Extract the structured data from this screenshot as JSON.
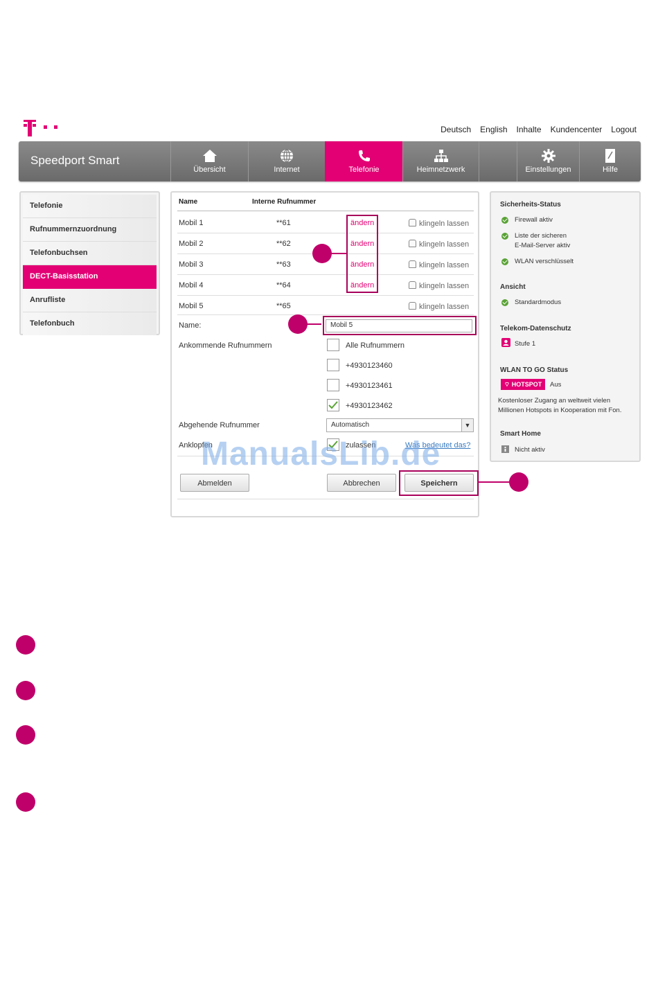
{
  "brand_color": "#e20074",
  "top_links": [
    "Deutsch",
    "English",
    "Inhalte",
    "Kundencenter",
    "Logout"
  ],
  "app_title": "Speedport Smart",
  "nav": [
    {
      "label": "Übersicht",
      "icon": "home-icon"
    },
    {
      "label": "Internet",
      "icon": "globe-icon"
    },
    {
      "label": "Telefonie",
      "icon": "phone-icon",
      "active": true
    },
    {
      "label": "Heimnetzwerk",
      "icon": "network-icon"
    },
    {
      "label": "Einstellungen",
      "icon": "gear-icon"
    },
    {
      "label": "Hilfe",
      "icon": "help-book-icon"
    }
  ],
  "sidebar": [
    {
      "label": "Telefonie"
    },
    {
      "label": "Rufnummernzuordnung"
    },
    {
      "label": "Telefonbuchsen"
    },
    {
      "label": "DECT-Basisstation",
      "active": true
    },
    {
      "label": "Anrufliste"
    },
    {
      "label": "Telefonbuch"
    }
  ],
  "table": {
    "col_name": "Name",
    "col_number": "Interne Rufnummer",
    "change_label": "ändern",
    "ring_label": "klingeln lassen",
    "rows": [
      {
        "name": "Mobil 1",
        "number": "**61"
      },
      {
        "name": "Mobil 2",
        "number": "**62"
      },
      {
        "name": "Mobil 3",
        "number": "**63"
      },
      {
        "name": "Mobil 4",
        "number": "**64"
      },
      {
        "name": "Mobil 5",
        "number": "**65"
      }
    ]
  },
  "form": {
    "name_label": "Name:",
    "name_value": "Mobil 5",
    "incoming_label": "Ankommende Rufnummern",
    "incoming_options": [
      {
        "label": "Alle Rufnummern",
        "checked": false
      },
      {
        "label": "+4930123460",
        "checked": false
      },
      {
        "label": "+4930123461",
        "checked": false
      },
      {
        "label": "+4930123462",
        "checked": true
      }
    ],
    "outgoing_label": "Abgehende Rufnummer",
    "outgoing_value": "Automatisch",
    "knock_label": "Anklopfen",
    "knock_option": "zulassen",
    "knock_checked": true,
    "help_link": "Was bedeutet das?",
    "logout_btn": "Abmelden",
    "cancel_btn": "Abbrechen",
    "save_btn": "Speichern"
  },
  "status": {
    "security_title": "Sicherheits-Status",
    "security_items": [
      "Firewall aktiv",
      "Liste der sicheren",
      "E-Mail-Server aktiv",
      "WLAN verschlüsselt"
    ],
    "view_title": "Ansicht",
    "view_item": "Standardmodus",
    "privacy_title": "Telekom-Datenschutz",
    "privacy_item": "Stufe 1",
    "wlan_title": "WLAN TO GO Status",
    "hotspot_badge": "HOTSPOT",
    "hotspot_state": "Aus",
    "hotspot_text_1": "Kostenloser Zugang an weltweit vielen",
    "hotspot_text_2": "Millionen Hotspots in Kooperation mit Fon.",
    "smarthome_title": "Smart Home",
    "smarthome_item": "Nicht aktiv"
  },
  "watermark": "ManualsLib.de"
}
